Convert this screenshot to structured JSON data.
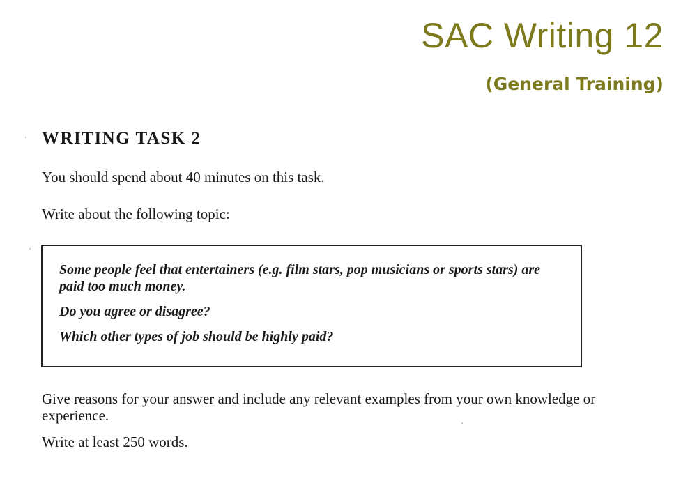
{
  "header": {
    "title": "SAC Writing 12",
    "subtitle": "(General Training)"
  },
  "task": {
    "heading": "WRITING TASK 2",
    "time_instruction": "You should spend about 40 minutes on this task.",
    "topic_instruction": "Write about the following topic:",
    "prompt": {
      "statement": "Some people feel that entertainers (e.g. film stars, pop musicians or sports stars) are paid too much money.",
      "question_1": "Do you agree or disagree?",
      "question_2": "Which other types of job should be highly paid?"
    },
    "reasons_instruction": "Give reasons for your answer and include any relevant examples from your own knowledge or experience.",
    "word_count_instruction": "Write at least 250 words."
  },
  "colors": {
    "brand": "#7d7a1e",
    "text": "#1a1a1a",
    "border": "#222222"
  }
}
